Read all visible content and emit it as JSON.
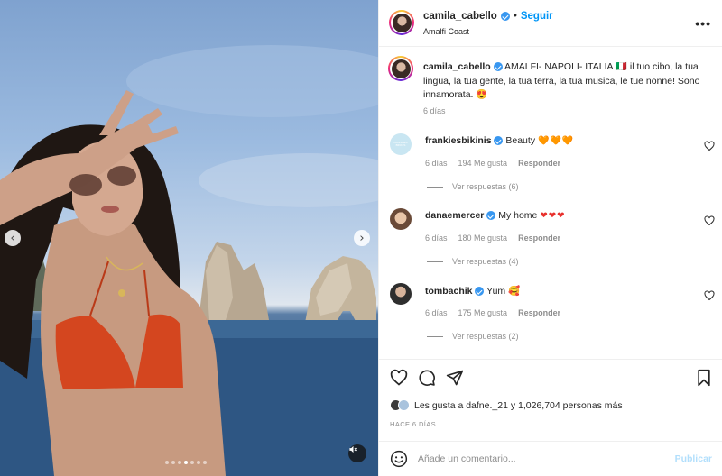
{
  "post": {
    "username": "camila_cabello",
    "follow_label": "Seguir",
    "separator": "•",
    "location": "Amalfi Coast",
    "more_label": "•••"
  },
  "caption": {
    "username": "camila_cabello",
    "text": "AMALFI- NAPOLI- ITALIA 🇮🇹 il tuo cibo, la tua lingua, la tua gente, la tua terra, la tua musica, le tue nonne! Sono innamorata. 😍",
    "time": "6 días"
  },
  "comments": [
    {
      "username": "frankiesbikinis",
      "text": "Beauty",
      "emoji": "🧡🧡🧡",
      "emoji_kind": "orange",
      "time": "6 días",
      "likes": "194 Me gusta",
      "reply_label": "Responder",
      "replies": "Ver respuestas (6)",
      "avatar_color": "#c9e6f2",
      "avatar_text": "FRANKIES BIKINIS"
    },
    {
      "username": "danaemercer",
      "text": "My home",
      "emoji": "❤❤❤",
      "emoji_kind": "red",
      "time": "6 días",
      "likes": "180 Me gusta",
      "reply_label": "Responder",
      "replies": "Ver respuestas (4)",
      "avatar_color": "#b88c6e"
    },
    {
      "username": "tombachik",
      "text": "Yum",
      "emoji": "🥰",
      "emoji_kind": "plain",
      "time": "6 días",
      "likes": "175 Me gusta",
      "reply_label": "Responder",
      "replies": "Ver respuestas (2)",
      "avatar_color": "#3c3c3c"
    }
  ],
  "likes": {
    "text": "Les gusta a dafne._21 y 1,026,704 personas más"
  },
  "timestamp": "HACE 6 DÍAS",
  "comment_box": {
    "placeholder": "Añade un comentario...",
    "publish_label": "Publicar"
  },
  "carousel": {
    "slide_count": 7,
    "active_index": 3
  },
  "colors": {
    "accent": "#0095f6",
    "verified": "#3897f0",
    "muted": "#8e8e8e"
  },
  "icons": [
    "chevron-left-icon",
    "chevron-right-icon",
    "mute-icon",
    "more-icon",
    "heart-icon",
    "comment-icon",
    "share-icon",
    "bookmark-icon",
    "smile-icon",
    "verified-icon"
  ]
}
